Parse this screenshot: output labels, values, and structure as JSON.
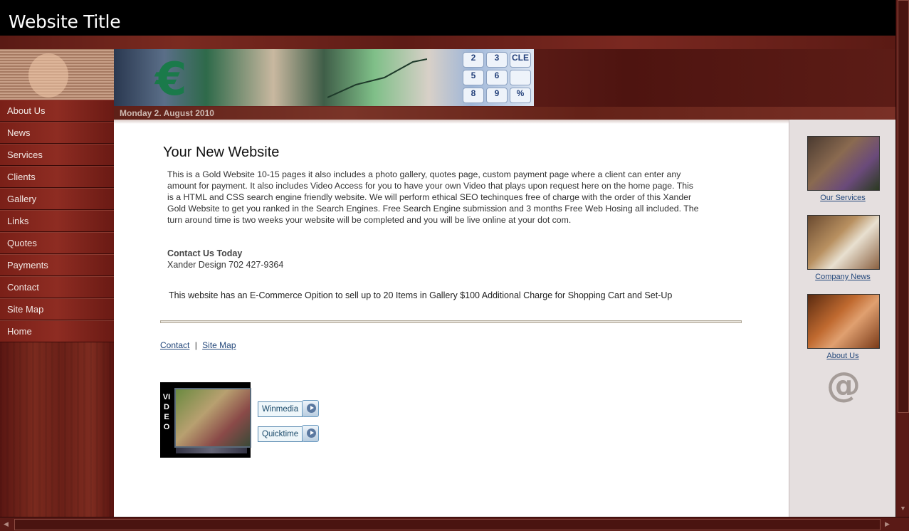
{
  "header": {
    "site_title": "Website Title"
  },
  "date_bar": {
    "date": "Monday 2. August 2010"
  },
  "banner": {
    "keypad": [
      "2",
      "3",
      "CLE",
      "5",
      "6",
      "",
      "8",
      "9",
      "%"
    ]
  },
  "sidebar": {
    "items": [
      {
        "label": "About Us"
      },
      {
        "label": "News"
      },
      {
        "label": "Services"
      },
      {
        "label": "Clients"
      },
      {
        "label": "Gallery"
      },
      {
        "label": "Links"
      },
      {
        "label": "Quotes"
      },
      {
        "label": "Payments"
      },
      {
        "label": "Contact"
      },
      {
        "label": "Site Map"
      },
      {
        "label": "Home"
      }
    ]
  },
  "main": {
    "title": "Your New Website",
    "body": "This is a Gold Website 10-15 pages it also includes a photo gallery, quotes page, custom payment page where a client can enter any amount for payment. It also includes Video Access for you to have your own Video that plays upon request here on the home page. This is a HTML and CSS search engine friendly website. We will perform ethical SEO techinques free of charge with the order of this Xander Gold Website to get you ranked in the Search Engines. Free Search Engine submission and 3 months Free Web Hosing all included. The turn around time is two weeks your website will be completed and you will be live online at your dot com.",
    "contact_heading": "Contact Us Today",
    "contact_line": "Xander Design 702 427-9364",
    "ecommerce_note": "This website has an E-Commerce Opition to sell up to 20 Items in Gallery $100 Additional Charge for Shopping Cart and Set-Up",
    "footer_links": {
      "contact": "Contact",
      "separator": "|",
      "site_map": "Site Map"
    },
    "video": {
      "label": "VIDEO",
      "winmedia": "Winmedia",
      "quicktime": "Quicktime"
    }
  },
  "right_col": {
    "links": [
      {
        "label": "Our Services"
      },
      {
        "label": "Company News"
      },
      {
        "label": "About Us"
      }
    ],
    "at_symbol": "@"
  }
}
